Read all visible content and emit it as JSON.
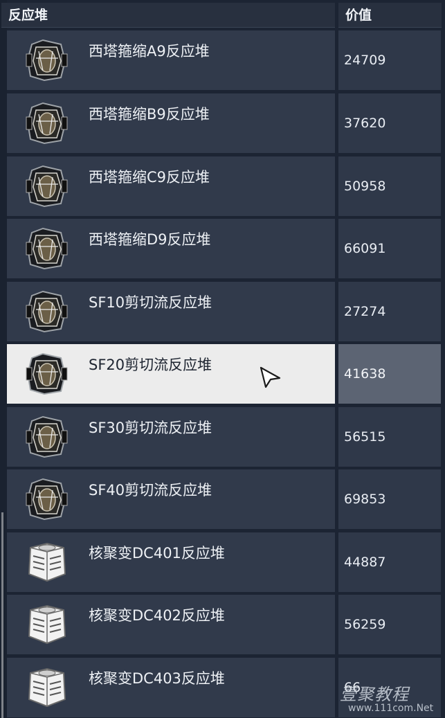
{
  "header": {
    "name_label": "反应堆",
    "value_label": "价值"
  },
  "rows": [
    {
      "name": "西塔箍缩A9反应堆",
      "value": "24709",
      "icon": "dark-reactor-icon",
      "selected": false
    },
    {
      "name": "西塔箍缩B9反应堆",
      "value": "37620",
      "icon": "dark-reactor-icon",
      "selected": false
    },
    {
      "name": "西塔箍缩C9反应堆",
      "value": "50958",
      "icon": "dark-reactor-icon",
      "selected": false
    },
    {
      "name": "西塔箍缩D9反应堆",
      "value": "66091",
      "icon": "dark-reactor-icon",
      "selected": false
    },
    {
      "name": "SF10剪切流反应堆",
      "value": "27274",
      "icon": "dark-reactor-icon",
      "selected": false
    },
    {
      "name": "SF20剪切流反应堆",
      "value": "41638",
      "icon": "dark-reactor-icon",
      "selected": true
    },
    {
      "name": "SF30剪切流反应堆",
      "value": "56515",
      "icon": "dark-reactor-icon",
      "selected": false
    },
    {
      "name": "SF40剪切流反应堆",
      "value": "69853",
      "icon": "dark-reactor-icon",
      "selected": false
    },
    {
      "name": "核聚变DC401反应堆",
      "value": "44887",
      "icon": "white-reactor-icon",
      "selected": false
    },
    {
      "name": "核聚变DC402反应堆",
      "value": "56259",
      "icon": "white-reactor-icon",
      "selected": false
    },
    {
      "name": "核聚变DC403反应堆",
      "value": "66",
      "icon": "white-reactor-icon",
      "selected": false
    }
  ],
  "watermark": {
    "title": "壹聚教程",
    "url": "www.111com.Net"
  },
  "colors": {
    "background": "#1c2433",
    "row": "#313a4b",
    "selected_row": "#ececec",
    "selected_value": "#5c6473"
  }
}
